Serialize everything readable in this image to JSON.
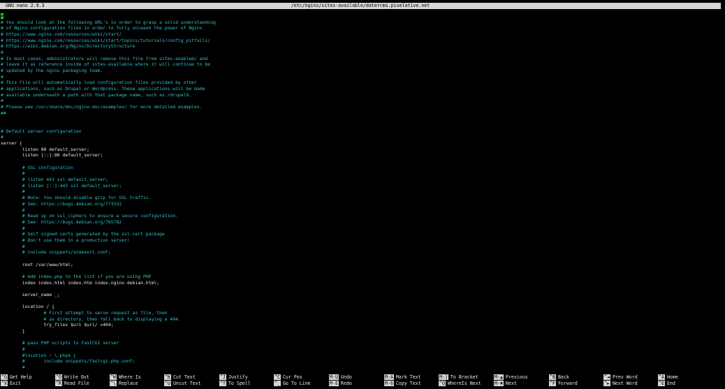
{
  "titlebar": {
    "app": "GNU nano 2.9.3",
    "path": "/etc/nginx/sites-available/datercms.pixelative.net"
  },
  "colors": {
    "comment": "#2ec4cc",
    "code": "#eaeaea",
    "cursor": "#2ee02e",
    "bar": "#d6d6d6",
    "background": "#000000"
  },
  "editor": {
    "cursor_char": "#",
    "lines": [
      {
        "text": "#",
        "type": "comment"
      },
      {
        "text": "# You should look at the following URL's in order to grasp a solid understanding",
        "type": "comment"
      },
      {
        "text": "# of Nginx configuration files in order to fully unleash the power of Nginx.",
        "type": "comment"
      },
      {
        "text": "# https://www.nginx.com/resources/wiki/start/",
        "type": "comment"
      },
      {
        "text": "# https://www.nginx.com/resources/wiki/start/topics/tutorials/config_pitfalls/",
        "type": "comment"
      },
      {
        "text": "# https://wiki.debian.org/Nginx/DirectoryStructure",
        "type": "comment"
      },
      {
        "text": "#",
        "type": "comment"
      },
      {
        "text": "# In most cases, administrators will remove this file from sites-enabled/ and",
        "type": "comment"
      },
      {
        "text": "# leave it as reference inside of sites-available where it will continue to be",
        "type": "comment"
      },
      {
        "text": "# updated by the nginx packaging team.",
        "type": "comment"
      },
      {
        "text": "#",
        "type": "comment"
      },
      {
        "text": "# This file will automatically load configuration files provided by other",
        "type": "comment"
      },
      {
        "text": "# applications, such as Drupal or Wordpress. These applications will be made",
        "type": "comment"
      },
      {
        "text": "# available underneath a path with that package name, such as /drupal8.",
        "type": "comment"
      },
      {
        "text": "#",
        "type": "comment"
      },
      {
        "text": "# Please see /usr/share/doc/nginx-doc/examples/ for more detailed examples.",
        "type": "comment"
      },
      {
        "text": "##",
        "type": "comment"
      },
      {
        "text": "",
        "type": "code"
      },
      {
        "text": "",
        "type": "code"
      },
      {
        "text": "# Default server configuration",
        "type": "comment"
      },
      {
        "text": "#",
        "type": "comment"
      },
      {
        "text": "server {",
        "type": "code"
      },
      {
        "text": "        listen 80 default_server;",
        "type": "code"
      },
      {
        "text": "        listen [::]:80 default_server;",
        "type": "code"
      },
      {
        "text": "",
        "type": "code"
      },
      {
        "text": "        # SSL configuration",
        "type": "comment"
      },
      {
        "text": "        #",
        "type": "comment"
      },
      {
        "text": "        # listen 443 ssl default_server;",
        "type": "comment"
      },
      {
        "text": "        # listen [::]:443 ssl default_server;",
        "type": "comment"
      },
      {
        "text": "        #",
        "type": "comment"
      },
      {
        "text": "        # Note: You should disable gzip for SSL traffic.",
        "type": "comment"
      },
      {
        "text": "        # See: https://bugs.debian.org/773332",
        "type": "comment"
      },
      {
        "text": "        #",
        "type": "comment"
      },
      {
        "text": "        # Read up on ssl_ciphers to ensure a secure configuration.",
        "type": "comment"
      },
      {
        "text": "        # See: https://bugs.debian.org/765782",
        "type": "comment"
      },
      {
        "text": "        #",
        "type": "comment"
      },
      {
        "text": "        # Self signed certs generated by the ssl-cert package",
        "type": "comment"
      },
      {
        "text": "        # Don't use them in a production server!",
        "type": "comment"
      },
      {
        "text": "        #",
        "type": "comment"
      },
      {
        "text": "        # include snippets/snakeoil.conf;",
        "type": "comment"
      },
      {
        "text": "",
        "type": "code"
      },
      {
        "text": "        root /var/www/html;",
        "type": "code"
      },
      {
        "text": "",
        "type": "code"
      },
      {
        "text": "        # Add index.php to the list if you are using PHP",
        "type": "comment"
      },
      {
        "text": "        index index.html index.htm index.nginx-debian.html;",
        "type": "code"
      },
      {
        "text": "",
        "type": "code"
      },
      {
        "text": "        server_name _;",
        "type": "code"
      },
      {
        "text": "",
        "type": "code"
      },
      {
        "text": "        location / {",
        "type": "code"
      },
      {
        "text": "                # First attempt to serve request as file, then",
        "type": "comment"
      },
      {
        "text": "                # as directory, then fall back to displaying a 404.",
        "type": "comment"
      },
      {
        "text": "                try_files $uri $uri/ =404;",
        "type": "code"
      },
      {
        "text": "        }",
        "type": "code"
      },
      {
        "text": "",
        "type": "code"
      },
      {
        "text": "        # pass PHP scripts to FastCGI server",
        "type": "comment"
      },
      {
        "text": "        #",
        "type": "comment"
      },
      {
        "text": "        #location ~ \\.php$ {",
        "type": "comment"
      },
      {
        "text": "        #       include snippets/fastcgi-php.conf;",
        "type": "comment"
      },
      {
        "text": "        #",
        "type": "comment"
      }
    ]
  },
  "shortcuts": {
    "top": [
      {
        "key": "^G",
        "label": "Get Help"
      },
      {
        "key": "^O",
        "label": "Write Out"
      },
      {
        "key": "^W",
        "label": "Where Is"
      },
      {
        "key": "^K",
        "label": "Cut Text"
      },
      {
        "key": "^J",
        "label": "Justify"
      },
      {
        "key": "^C",
        "label": "Cur Pos"
      },
      {
        "key": "M-U",
        "label": "Undo"
      },
      {
        "key": "M-A",
        "label": "Mark Text"
      },
      {
        "key": "M-]",
        "label": "To Bracket"
      },
      {
        "key": "M-▲",
        "label": "Previous"
      },
      {
        "key": "^B",
        "label": "Back"
      },
      {
        "key": "^◄",
        "label": "Prev Word"
      },
      {
        "key": "^A",
        "label": "Home"
      }
    ],
    "bottom": [
      {
        "key": "^X",
        "label": "Exit"
      },
      {
        "key": "^R",
        "label": "Read File"
      },
      {
        "key": "^\\",
        "label": "Replace"
      },
      {
        "key": "^U",
        "label": "Uncut Text"
      },
      {
        "key": "^T",
        "label": "To Spell"
      },
      {
        "key": "^_",
        "label": "Go To Line"
      },
      {
        "key": "M-E",
        "label": "Redo"
      },
      {
        "key": "M-6",
        "label": "Copy Text"
      },
      {
        "key": "^Q",
        "label": "WhereIs Next"
      },
      {
        "key": "M-▼",
        "label": "Next"
      },
      {
        "key": "^F",
        "label": "Forward"
      },
      {
        "key": "^►",
        "label": "Next Word"
      },
      {
        "key": "^E",
        "label": "End"
      }
    ]
  }
}
